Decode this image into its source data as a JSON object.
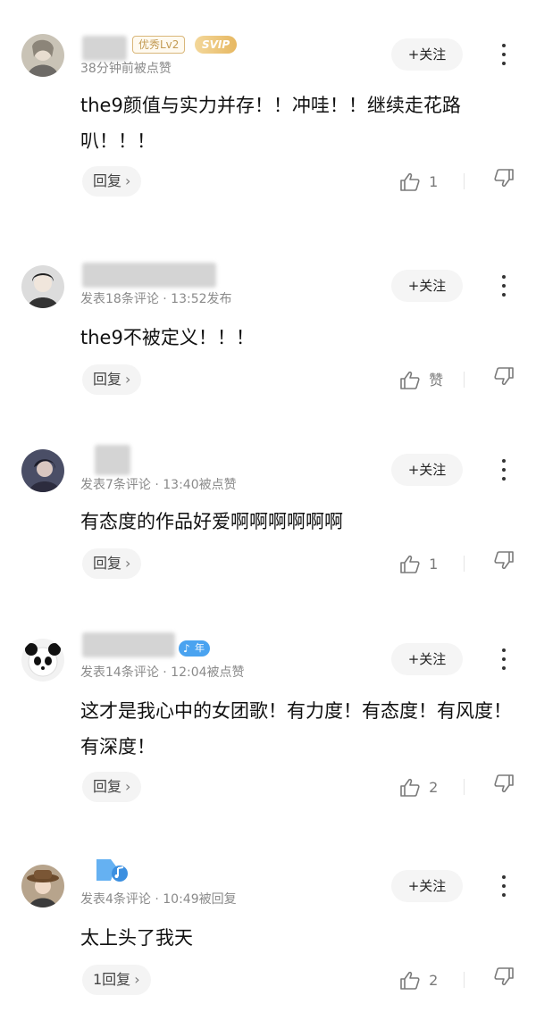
{
  "comments": [
    {
      "meta": "38分钟前被点赞",
      "level_badge": "优秀Lv2",
      "svip_badge": "SVIP",
      "text": "the9颜值与实力并存！！冲哇！！继续走花路叭！！！",
      "reply_label": "回复",
      "like_count": "1",
      "follow_label": "+关注"
    },
    {
      "meta": "发表18条评论 · 13:52发布",
      "text": "the9不被定义！！！",
      "reply_label": "回复",
      "like_count": "赞",
      "follow_label": "+关注"
    },
    {
      "meta": "发表7条评论 · 13:40被点赞",
      "text": "有态度的作品好爱啊啊啊啊啊啊",
      "reply_label": "回复",
      "like_count": "1",
      "follow_label": "+关注"
    },
    {
      "meta": "发表14条评论 · 12:04被点赞",
      "badge": "年",
      "text": "这才是我心中的女团歌！有力度！有态度！有风度！有深度！",
      "reply_label": "回复",
      "like_count": "2",
      "follow_label": "+关注"
    },
    {
      "meta": "发表4条评论 · 10:49被回复",
      "text": "太上头了我天",
      "reply_label": "1回复",
      "like_count": "2",
      "follow_label": "+关注"
    }
  ],
  "icons": {
    "chevron": "chevron-right-icon",
    "like": "thumbs-up-icon",
    "dislike": "thumbs-down-icon",
    "more": "more-vertical-icon",
    "music": "music-note-icon"
  },
  "colors": {
    "svip": "#e7b862",
    "music_badge": "#4aa3f0",
    "follow_bg": "#f5f5f5"
  }
}
